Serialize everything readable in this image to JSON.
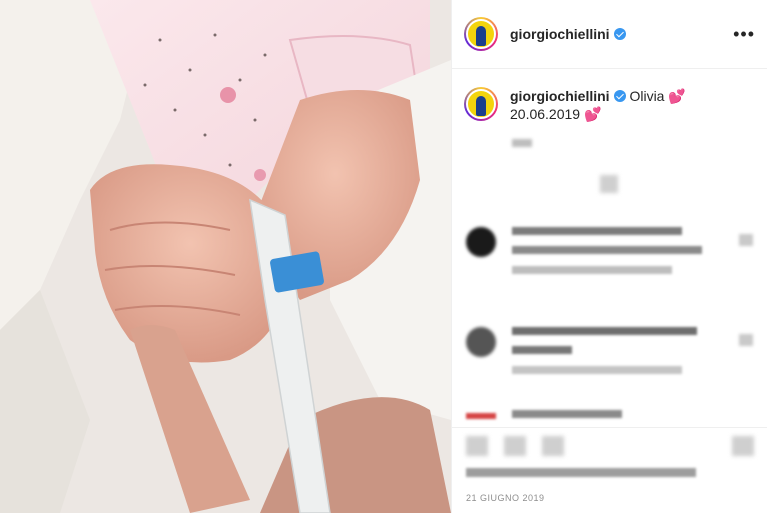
{
  "post": {
    "username": "giorgiochiellini",
    "caption_text": "Olivia",
    "caption_emoji": "💕",
    "caption_date": "20.06.2019",
    "date": "21 GIUGNO 2019"
  },
  "header": {
    "username": "giorgiochiellini",
    "more_label": "•••"
  },
  "colors": {
    "verified": "#3897f0",
    "text": "#262626",
    "muted": "#8e8e8e"
  },
  "icons": [
    "verified-badge-icon",
    "more-options-icon",
    "heart-icon",
    "comment-icon",
    "share-icon",
    "bookmark-icon"
  ]
}
